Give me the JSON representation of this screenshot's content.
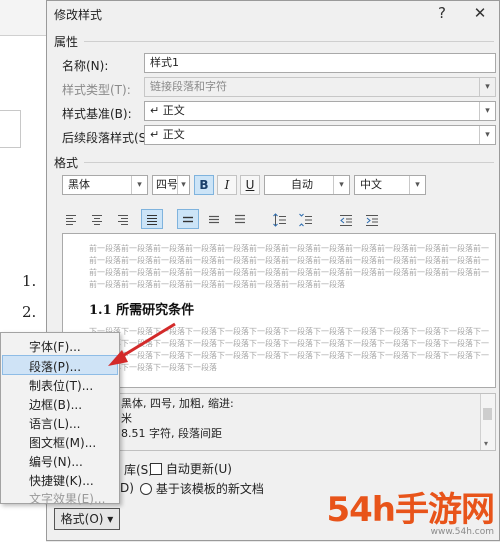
{
  "dialog": {
    "title": "修改样式",
    "help": "?",
    "close": "✕"
  },
  "properties": {
    "header": "属性",
    "name_label": "名称(N):",
    "name_value": "样式1",
    "type_label": "样式类型(T):",
    "type_value": "链接段落和字符",
    "based_label": "样式基准(B):",
    "based_value": "↵ 正文",
    "following_label": "后续段落样式(S):",
    "following_value": "↵ 正文"
  },
  "formatting": {
    "header": "格式",
    "font": "黑体",
    "size": "四号",
    "bold": "B",
    "italic": "I",
    "underline": "U",
    "color": "自动",
    "script": "中文"
  },
  "preview": {
    "before_lines": [
      "前一段落前一段落前一段落前一段落前一段落前一段落前一段落前一段落前一段落前一段落前一段落前一段落前一段落前一段落前",
      "前一段落前一段落前一段落前一段落前一段落前一段落前一段落前一段落前一段落前一段落前一段落前一段落前一段落前一段落前",
      "前一段落前一段落前一段落前一段落前一段落前一段落前一段落前一段落前一段落前一段落前一段落前一段落前一段落前一段落前",
      "前一段落前一段落前一段落前一段落前一段落前一段落前一段落前一段落"
    ],
    "sample_title": "1.1 所需研究条件",
    "after_lines": [
      "下一段落下一段落下一段落下一段落下一段落下一段落下一段落下一段落下一段落下一段落下一段落下一段落下一段落下",
      "下一段落下一段落下一段落下一段落下一段落下一段落下一段落下一段落下一段落下一段落下一段落下一段落下一段落下",
      "下一段落下一段落下一段落下一段落下一段落下一段落下一段落下一段落下一段落下一段落下一段落下一段落下一段落下",
      "下一段落下一段落下一段落下一段落"
    ]
  },
  "description": {
    "line1": "黑体, 四号, 加粗, 缩进:",
    "line2": "米",
    "line3": "8.51 字符, 段落间距"
  },
  "options": {
    "add_to_gallery": "库(S)",
    "auto_update": "自动更新(U)",
    "only_this_doc": "D)",
    "new_docs": "基于该模板的新文档"
  },
  "format_button": "格式(O) ▾",
  "menu": {
    "items": [
      "字体(F)...",
      "段落(P)...",
      "制表位(T)...",
      "边框(B)...",
      "语言(L)...",
      "图文框(M)...",
      "编号(N)...",
      "快捷键(K)...",
      "文字效果(E)..."
    ]
  },
  "document": {
    "list1": "1.",
    "list2": "2."
  },
  "watermark": {
    "text": "54h手游网",
    "domain": "www.54h.com",
    "color": "#e8541a"
  },
  "colors": {
    "highlight": "#cfe3f6",
    "arrow": "#d32a2a"
  }
}
